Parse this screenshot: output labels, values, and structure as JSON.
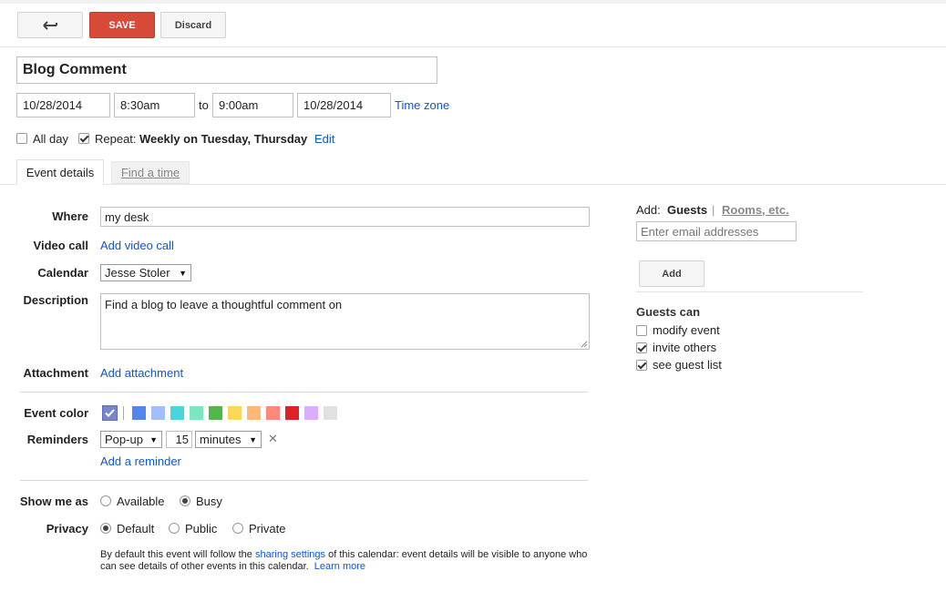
{
  "toolbar": {
    "save_label": "SAVE",
    "discard_label": "Discard"
  },
  "event": {
    "title": "Blog Comment",
    "start_date": "10/28/2014",
    "start_time": "8:30am",
    "to_label": "to",
    "end_time": "9:00am",
    "end_date": "10/28/2014",
    "timezone_link": "Time zone",
    "all_day_label": "All day",
    "repeat_label": "Repeat:",
    "repeat_value": "Weekly on Tuesday, Thursday",
    "repeat_edit": "Edit"
  },
  "tabs": {
    "event_details": "Event details",
    "find_time": "Find a time"
  },
  "details": {
    "where_label": "Where",
    "where_value": "my desk",
    "video_label": "Video call",
    "video_link": "Add video call",
    "calendar_label": "Calendar",
    "calendar_value": "Jesse Stoler",
    "description_label": "Description",
    "description_value": "Find a blog to leave a thoughtful comment on",
    "attachment_label": "Attachment",
    "attachment_link": "Add attachment",
    "color_label": "Event color",
    "colors": [
      "#5484ed",
      "#a4bdfc",
      "#46d6db",
      "#7ae7bf",
      "#51b749",
      "#fbd75b",
      "#ffb878",
      "#ff887c",
      "#dc2127",
      "#dbadff",
      "#e1e1e1"
    ],
    "reminders_label": "Reminders",
    "reminder_type": "Pop-up",
    "reminder_amount": "15",
    "reminder_unit": "minutes",
    "add_reminder": "Add a reminder",
    "show_me_label": "Show me as",
    "available_label": "Available",
    "busy_label": "Busy",
    "privacy_label": "Privacy",
    "default_label": "Default",
    "public_label": "Public",
    "private_label": "Private",
    "note_pre": "By default this event will follow the",
    "note_link": "sharing settings",
    "note_mid": "of this calendar: event details will be visible to anyone who",
    "note_line2": "can see details of other events in this calendar.",
    "learn_more": "Learn more"
  },
  "guests": {
    "add_label": "Add:",
    "guests_tab": "Guests",
    "separator": "|",
    "rooms_tab": "Rooms, etc.",
    "email_placeholder": "Enter email addresses",
    "add_button": "Add",
    "guests_can_label": "Guests can",
    "modify_label": "modify event",
    "invite_label": "invite others",
    "see_list_label": "see guest list"
  }
}
